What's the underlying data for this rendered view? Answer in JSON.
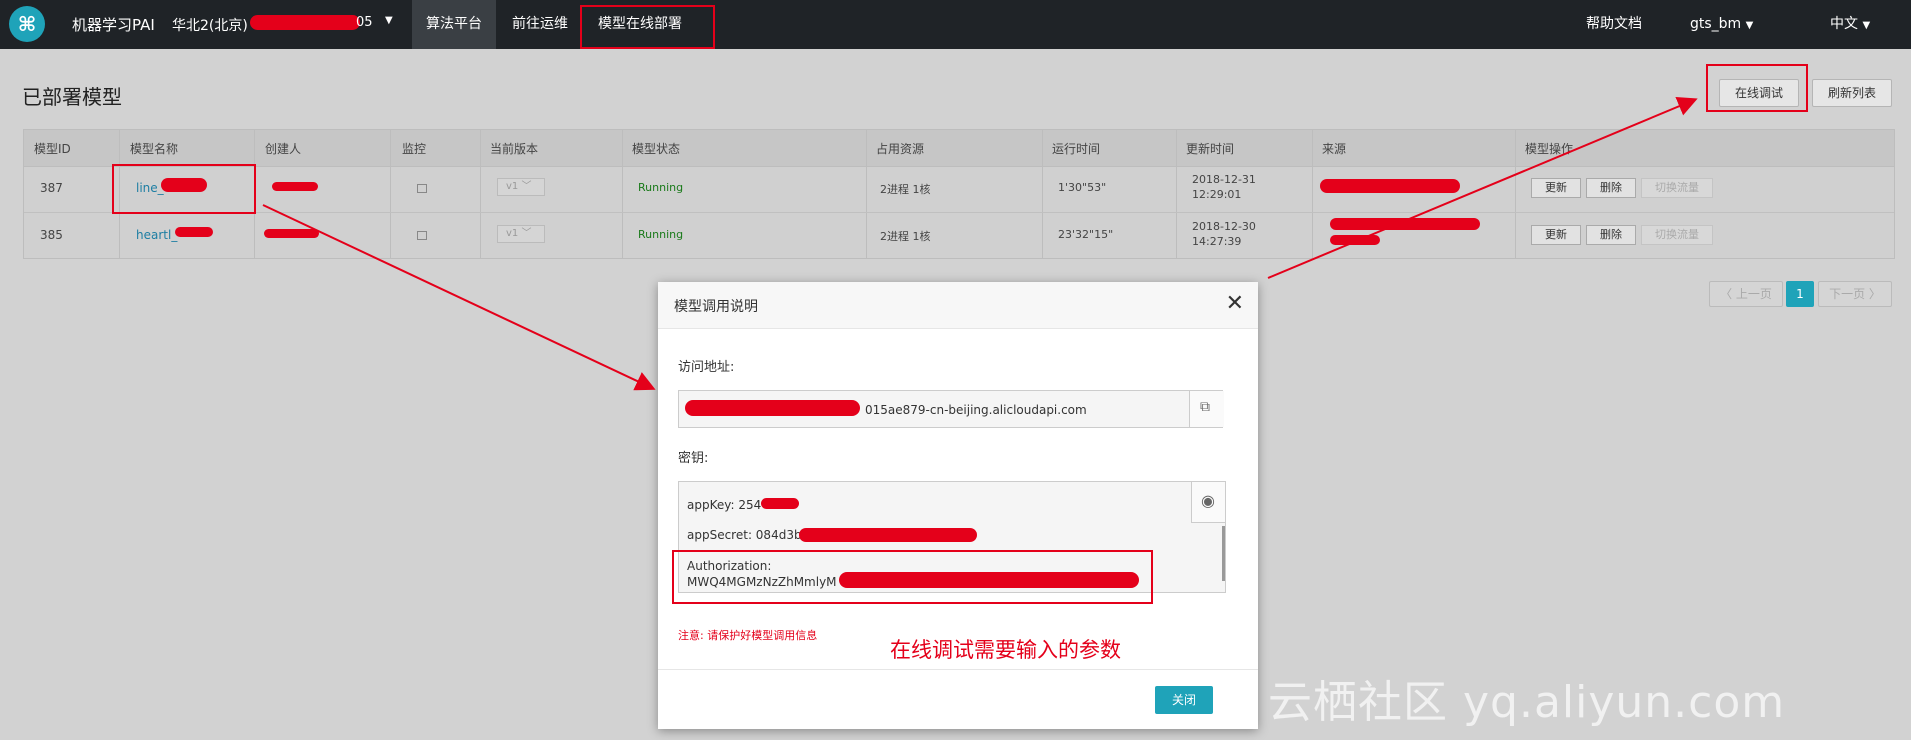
{
  "topbar": {
    "logo_glyph": "⌘",
    "app_title": "机器学习PAI",
    "region": "华北2(北京)",
    "region_suffix": "05",
    "nav": [
      "算法平台",
      "前往运维",
      "模型在线部署"
    ],
    "help": "帮助文档",
    "user": "gts_bm",
    "language": "中文"
  },
  "page": {
    "title": "已部署模型",
    "online_debug_button": "在线调试",
    "refresh_button": "刷新列表"
  },
  "table": {
    "headers": [
      "模型ID",
      "模型名称",
      "创建人",
      "监控",
      "当前版本",
      "模型状态",
      "占用资源",
      "运行时间",
      "更新时间",
      "来源",
      "模型操作"
    ],
    "rows": [
      {
        "id": "387",
        "name": "line_",
        "version": "v1",
        "status": "Running",
        "resources": "2进程  1核",
        "uptime": "1'30\"53\"",
        "updated_date": "2018-12-31",
        "updated_time": "12:29:01",
        "actions": [
          "更新",
          "删除",
          "切换流量"
        ]
      },
      {
        "id": "385",
        "name": "heartl_",
        "version": "v1",
        "status": "Running",
        "resources": "2进程  1核",
        "uptime": "23'32\"15\"",
        "updated_date": "2018-12-30",
        "updated_time": "14:27:39",
        "actions": [
          "更新",
          "删除",
          "切换流量"
        ]
      }
    ]
  },
  "pager": {
    "prev": "〈 上一页",
    "current": "1",
    "next": "下一页 〉"
  },
  "modal": {
    "title": "模型调用说明",
    "close_glyph": "✕",
    "address_label": "访问地址:",
    "address_value": "015ae879-cn-beijing.alicloudapi.com",
    "key_label": "密钥:",
    "app_key": "appKey: 254",
    "app_secret": "appSecret: 084d3b8",
    "authorization_label": "Authorization:",
    "authorization_value": "MWQ4MGMzNzZhMmlyM",
    "warning": "注意: 请保护好模型调用信息",
    "annotation": "在线调试需要输入的参数",
    "close_button": "关闭"
  },
  "watermark": "云栖社区 yq.aliyun.com",
  "colors": {
    "accent": "#1fa3b9",
    "annotation_red": "#e4001a",
    "topbar": "#1f2327"
  }
}
